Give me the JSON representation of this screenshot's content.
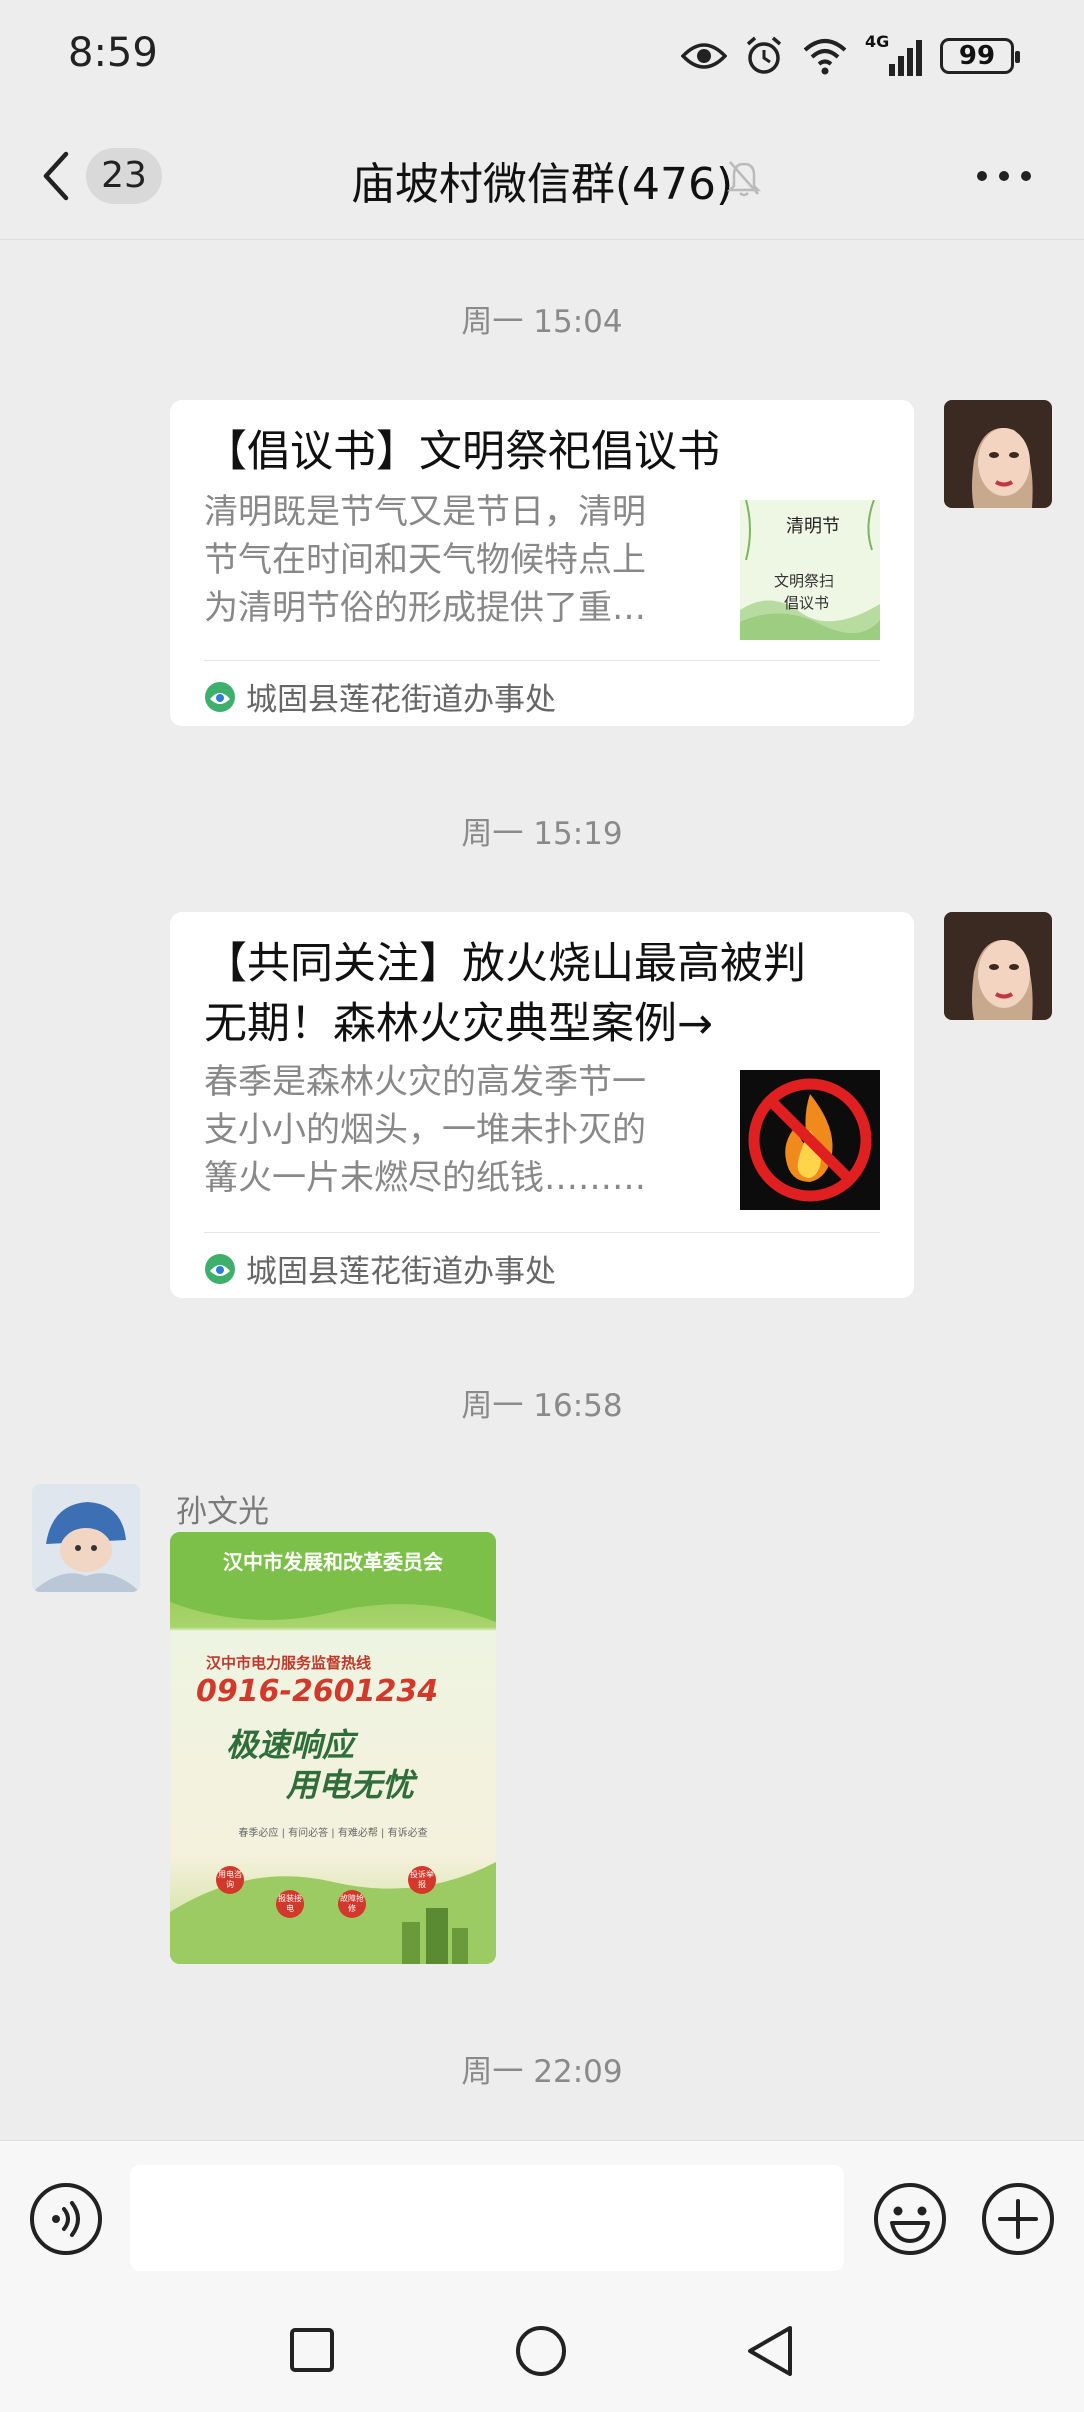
{
  "status_bar": {
    "time": "8:59",
    "network_label": "4G",
    "battery": "99"
  },
  "header": {
    "unread_count": "23",
    "title": "庙坡村微信群(476)"
  },
  "messages": [
    {
      "timestamp": "周一 15:04",
      "card": {
        "title": "【倡议书】文明祭祀倡议书",
        "desc_lines": [
          "清明既是节气又是节日，清明",
          "节气在时间和天气物候特点上",
          "为清明节俗的形成提供了重…"
        ],
        "thumb_lines": [
          "清明节",
          "文明祭扫",
          "倡议书"
        ],
        "source": "城固县莲花街道办事处"
      }
    },
    {
      "timestamp": "周一 15:19",
      "card": {
        "title_lines": [
          "【共同关注】放火烧山最高被判",
          "无期！森林火灾典型案例→"
        ],
        "desc_lines": [
          "春季是森林火灾的高发季节一",
          "支小小的烟头，一堆未扑灭的",
          "篝火一片未燃尽的纸钱………"
        ],
        "source": "城固县莲花街道办事处"
      }
    },
    {
      "timestamp": "周一 16:58",
      "sender": "孙文光",
      "poster": {
        "org": "汉中市发展和改革委员会",
        "hotline_label": "汉中市电力服务监督热线",
        "phone": "0916-2601234",
        "slogan_1": "极速响应",
        "slogan_2": "用电无忧",
        "tagline": "春季必应 | 有问必答 | 有难必帮 | 有诉必查",
        "bubbles": [
          "用电咨询",
          "报装接电",
          "故障抢修",
          "投诉举报"
        ]
      }
    },
    {
      "timestamp": "周一 22:09"
    }
  ]
}
